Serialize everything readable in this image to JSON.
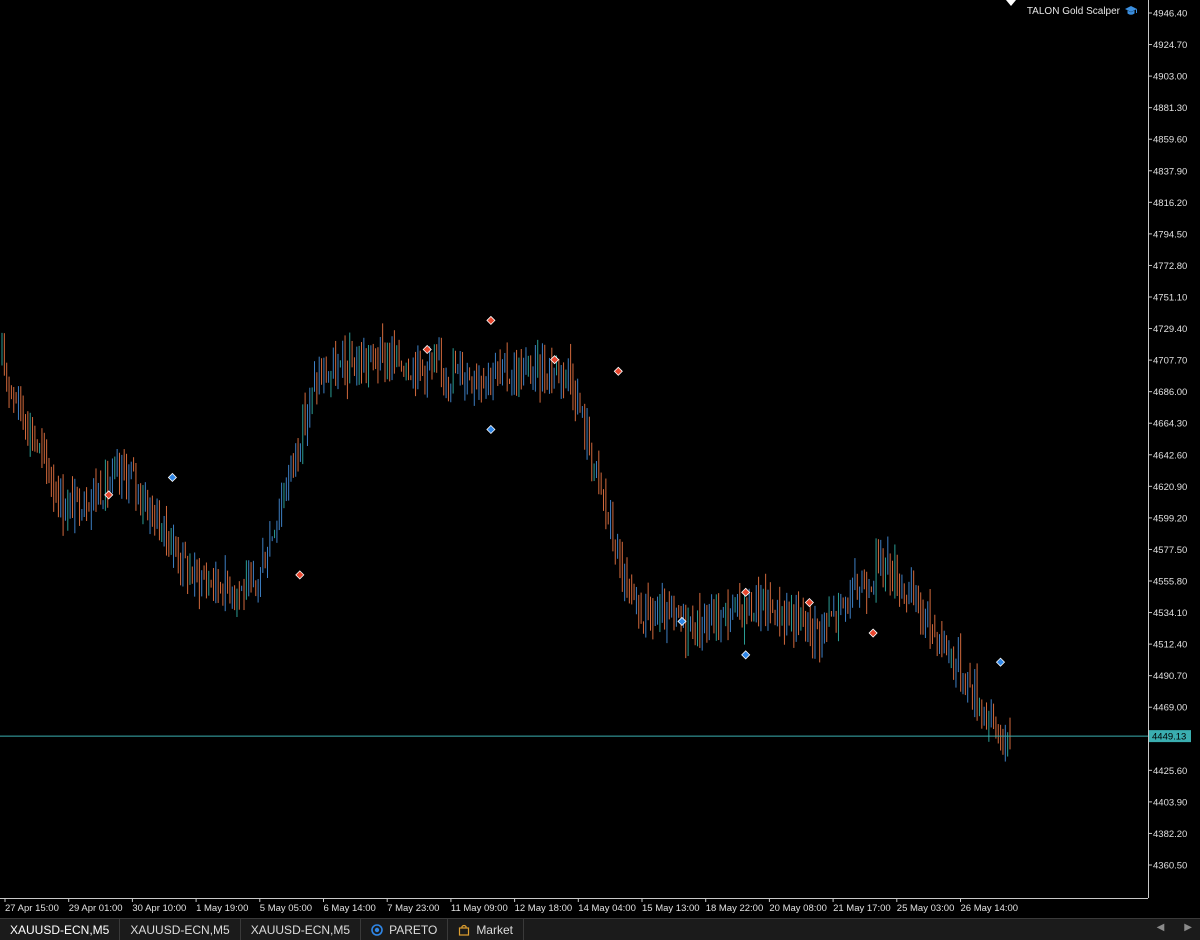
{
  "indicator": {
    "name": "TALON Gold Scalper",
    "icon": "graduation-cap-icon"
  },
  "price_axis": {
    "labels": [
      "4946.40",
      "4924.70",
      "4903.00",
      "4881.30",
      "4859.60",
      "4837.90",
      "4816.20",
      "4794.50",
      "4772.80",
      "4751.10",
      "4729.40",
      "4707.70",
      "4686.00",
      "4664.30",
      "4642.60",
      "4620.90",
      "4599.20",
      "4577.50",
      "4555.80",
      "4534.10",
      "4512.40",
      "4490.70",
      "4469.00",
      "4425.60",
      "4403.90",
      "4382.20",
      "4360.50"
    ],
    "current_price": "4449.13"
  },
  "time_axis": {
    "labels": [
      "27 Apr 15:00",
      "29 Apr 01:00",
      "30 Apr 10:00",
      "1 May 19:00",
      "5 May 05:00",
      "6 May 14:00",
      "7 May 23:00",
      "11 May 09:00",
      "12 May 18:00",
      "14 May 04:00",
      "15 May 13:00",
      "18 May 22:00",
      "20 May 08:00",
      "21 May 17:00",
      "25 May 03:00",
      "26 May 14:00"
    ]
  },
  "colors": {
    "background": "#000000",
    "bull": "#3d7fc4",
    "bear": "#d2693c",
    "teal": "#2a9d94",
    "current_price_line": "#3aaeb0",
    "buy_marker": "#2f86e6",
    "sell_marker": "#e8462e"
  },
  "chart_data": {
    "type": "line",
    "symbol": "XAUUSD-ECN",
    "timeframe": "M5",
    "ylim": [
      4350,
      4950
    ],
    "x": [
      "27 Apr 15:00",
      "29 Apr 01:00",
      "30 Apr 10:00",
      "1 May 19:00",
      "5 May 05:00",
      "6 May 14:00",
      "7 May 23:00",
      "11 May 09:00",
      "12 May 18:00",
      "14 May 04:00",
      "15 May 13:00",
      "18 May 22:00",
      "20 May 08:00",
      "21 May 17:00",
      "25 May 03:00",
      "26 May 14:00",
      "26 May 18:00"
    ],
    "series": [
      {
        "name": "",
        "values": [
          4705,
          4605,
          4630,
          4560,
          4548,
          4695,
          4710,
          4700,
          4698,
          4702,
          4535,
          4525,
          4540,
          4522,
          4570,
          4510,
          4438
        ]
      }
    ],
    "signals": [
      {
        "x": "29 Apr 01:00",
        "type": "sell",
        "price": 4615
      },
      {
        "x": "30 Apr 10:00",
        "type": "buy",
        "price": 4627
      },
      {
        "x": "5 May 05:00",
        "type": "sell",
        "price": 4560
      },
      {
        "x": "7 May 23:00",
        "type": "sell",
        "price": 4715
      },
      {
        "x": "11 May 09:00",
        "type": "sell",
        "price": 4735
      },
      {
        "x": "11 May 09:00",
        "type": "buy",
        "price": 4660
      },
      {
        "x": "12 May 18:00",
        "type": "sell",
        "price": 4708
      },
      {
        "x": "14 May 04:00",
        "type": "sell",
        "price": 4700
      },
      {
        "x": "15 May 13:00",
        "type": "buy",
        "price": 4528
      },
      {
        "x": "18 May 22:00",
        "type": "sell",
        "price": 4548
      },
      {
        "x": "18 May 22:00",
        "type": "buy",
        "price": 4505
      },
      {
        "x": "20 May 08:00",
        "type": "sell",
        "price": 4541
      },
      {
        "x": "21 May 17:00",
        "type": "sell",
        "price": 4520
      },
      {
        "x": "26 May 14:00",
        "type": "buy",
        "price": 4500
      }
    ]
  },
  "tabs": [
    {
      "label": "XAUUSD-ECN,M5",
      "icon": ""
    },
    {
      "label": "XAUUSD-ECN,M5",
      "icon": ""
    },
    {
      "label": "XAUUSD-ECN,M5",
      "icon": ""
    },
    {
      "label": "PARETO",
      "icon": "pareto-icon"
    },
    {
      "label": "Market",
      "icon": "market-bag-icon"
    }
  ],
  "nav": {
    "left": "◀",
    "right": "▶"
  }
}
